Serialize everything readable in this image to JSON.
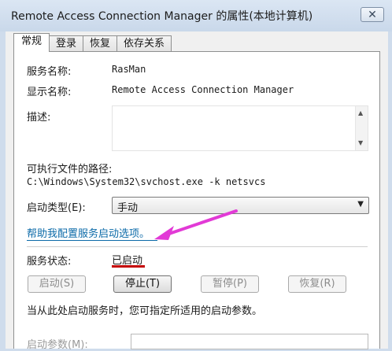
{
  "window": {
    "title": "Remote Access Connection Manager 的属性(本地计算机)",
    "close_label": "✕"
  },
  "tabs": [
    {
      "label": "常规"
    },
    {
      "label": "登录"
    },
    {
      "label": "恢复"
    },
    {
      "label": "依存关系"
    }
  ],
  "general": {
    "service_name_label": "服务名称:",
    "service_name": "RasMan",
    "display_name_label": "显示名称:",
    "display_name": "Remote Access Connection Manager",
    "description_label": "描述:",
    "description": "",
    "exe_path_label": "可执行文件的路径:",
    "exe_path": "C:\\Windows\\System32\\svchost.exe -k netsvcs",
    "startup_type_label": "启动类型(E):",
    "startup_type": "手动",
    "help_link": "帮助我配置服务启动选项。",
    "service_status_label": "服务状态:",
    "service_status": "已启动",
    "buttons": {
      "start": "启动(S)",
      "stop": "停止(T)",
      "pause": "暂停(P)",
      "resume": "恢复(R)"
    },
    "hint": "当从此处启动服务时，您可指定所适用的启动参数。",
    "start_params_label": "启动参数(M):",
    "start_params": ""
  },
  "colors": {
    "annotation_arrow": "#e23ad6",
    "status_underline": "#c40000",
    "link": "#0b6aa8"
  }
}
